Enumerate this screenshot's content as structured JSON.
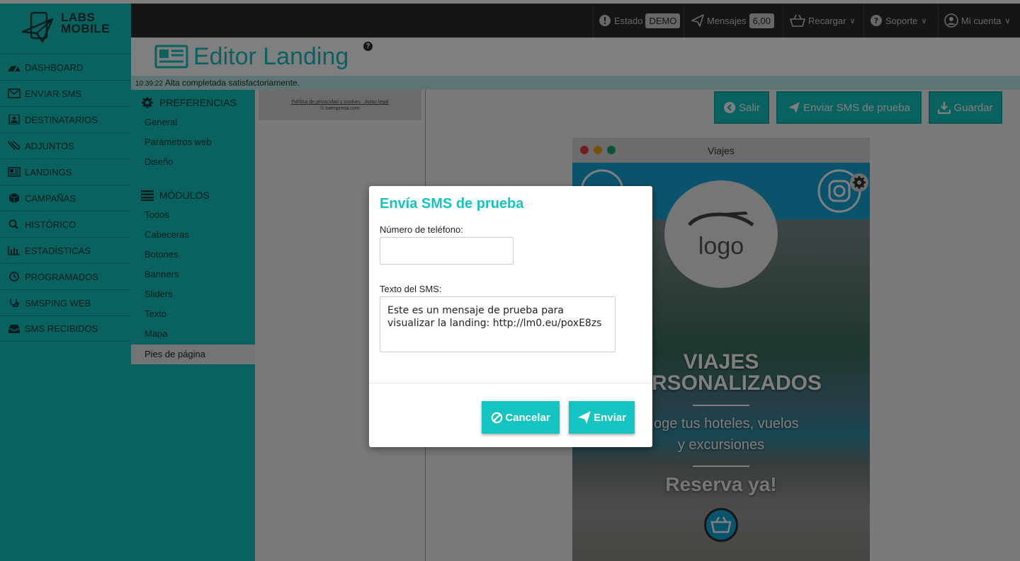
{
  "brand": {
    "line1": "LABS",
    "line2": "MOBILE"
  },
  "sidebar": {
    "items": [
      {
        "label": "DASHBOARD",
        "icon": "dashboard-icon"
      },
      {
        "label": "ENVIAR SMS",
        "icon": "envelope-icon"
      },
      {
        "label": "DESTINATARIOS",
        "icon": "contact-card-icon"
      },
      {
        "label": "ADJUNTOS",
        "icon": "paperclip-icon"
      },
      {
        "label": "LANDINGS",
        "icon": "newspaper-icon"
      },
      {
        "label": "CAMPAÑAS",
        "icon": "cube-icon"
      },
      {
        "label": "HISTÓRICO",
        "icon": "search-icon"
      },
      {
        "label": "ESTADÍSTICAS",
        "icon": "bar-chart-icon"
      },
      {
        "label": "PROGRAMADOS",
        "icon": "clock-icon"
      },
      {
        "label": "SMSPING WEB",
        "icon": "stethoscope-icon"
      },
      {
        "label": "SMS RECIBIDOS",
        "icon": "inbox-icon"
      }
    ]
  },
  "topbar": {
    "estado_label": "Estado",
    "estado_badge": "DEMO",
    "mensajes_label": "Mensajes",
    "mensajes_badge": "6,00",
    "recargar_label": "Recargar",
    "soporte_label": "Soporte",
    "cuenta_label": "Mi cuenta"
  },
  "editor": {
    "title": "Editor Landing",
    "help": "?",
    "status_time": "10:39:22",
    "status_text": "Alta completada satisfactoriamente."
  },
  "modules": {
    "preferencias_header": "PREFERENCIAS",
    "preferencias_items": [
      "General",
      "Parámetros web",
      "Diseño"
    ],
    "modulos_header": "MÓDULOS",
    "modulos_items": [
      "Todos",
      "Cabeceras",
      "Botones",
      "Banners",
      "Sliders",
      "Texto",
      "Mapa",
      "Pies de página"
    ]
  },
  "footer_snippet": {
    "line1": "Política de privacidad y cookies · Aviso legal",
    "line2": "© tuempresa.com"
  },
  "actions": {
    "salir": "Salir",
    "enviar_prueba": "Enviar SMS de prueba",
    "guardar": "Guardar"
  },
  "preview": {
    "title": "Viajes",
    "logo_text": "logo",
    "headline1": "VIAJES",
    "headline2": "RSONALIZADOS",
    "sub1": "oge tus hoteles, vuelos",
    "sub2": "y excursiones",
    "cta": "Reserva ya!"
  },
  "modal": {
    "title": "Envía SMS de prueba",
    "phone_label": "Número de teléfono:",
    "phone_value": "",
    "sms_label": "Texto del SMS:",
    "sms_value": "Este es un mensaje de prueba para visualizar la landing: http://lm0.eu/poxE8zs",
    "cancel": "Cancelar",
    "send": "Enviar"
  },
  "colors": {
    "accent": "#14c4c0",
    "topbar": "#2b2b2b",
    "header_blue": "#14a6d8"
  }
}
